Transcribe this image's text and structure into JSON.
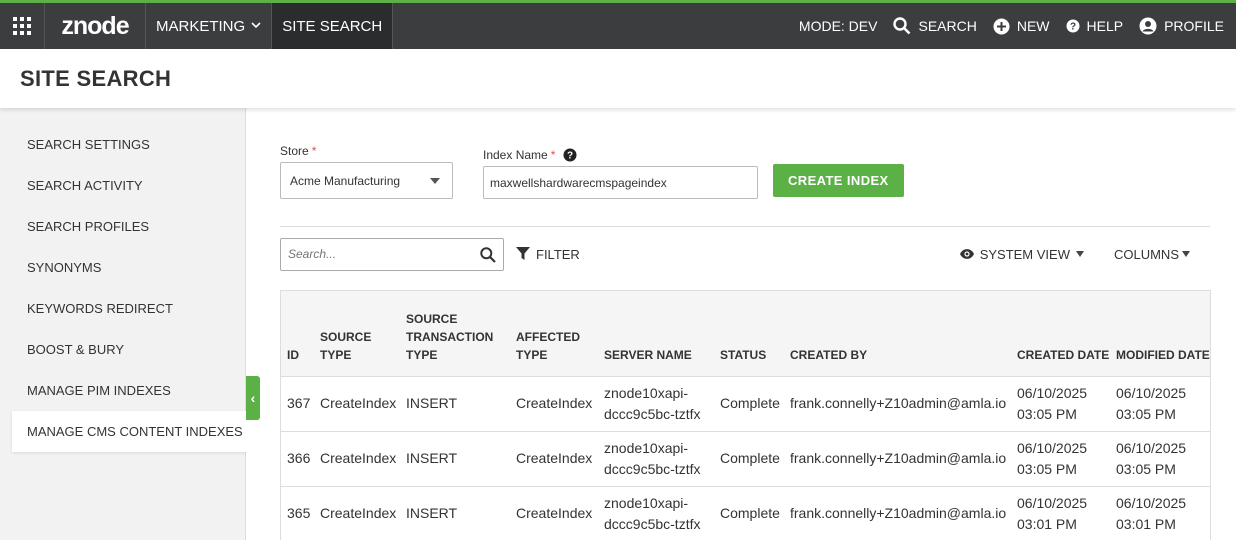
{
  "nav": {
    "logo": "znode",
    "menu": "MARKETING",
    "active": "SITE SEARCH",
    "mode": "MODE: DEV",
    "search": "SEARCH",
    "new": "NEW",
    "help": "HELP",
    "profile": "PROFILE"
  },
  "page": {
    "title": "SITE SEARCH"
  },
  "sidebar": {
    "items": [
      {
        "label": "SEARCH SETTINGS"
      },
      {
        "label": "SEARCH ACTIVITY"
      },
      {
        "label": "SEARCH PROFILES"
      },
      {
        "label": "SYNONYMS"
      },
      {
        "label": "KEYWORDS REDIRECT"
      },
      {
        "label": "BOOST & BURY"
      },
      {
        "label": "MANAGE PIM INDEXES"
      },
      {
        "label": "MANAGE CMS CONTENT INDEXES"
      }
    ],
    "collapse": "‹"
  },
  "form": {
    "store_label": "Store",
    "store_value": "Acme Manufacturing",
    "index_label": "Index Name",
    "index_value": "maxwellshardwarecmspageindex",
    "required_mark": "*",
    "create_button": "CREATE INDEX"
  },
  "toolbar": {
    "search_placeholder": "Search...",
    "filter": "FILTER",
    "system_view": "SYSTEM VIEW",
    "columns": "COLUMNS"
  },
  "table": {
    "headers": [
      "ID",
      "SOURCE TYPE",
      "SOURCE TRANSACTION TYPE",
      "AFFECTED TYPE",
      "SERVER NAME",
      "STATUS",
      "CREATED BY",
      "CREATED DATE",
      "MODIFIED DATE"
    ],
    "rows": [
      [
        "367",
        "CreateIndex",
        "INSERT",
        "CreateIndex",
        "znode10xapi-dccc9c5bc-tztfx",
        "Complete",
        "frank.connelly+Z10admin@amla.io",
        "06/10/2025 03:05 PM",
        "06/10/2025 03:05 PM"
      ],
      [
        "366",
        "CreateIndex",
        "INSERT",
        "CreateIndex",
        "znode10xapi-dccc9c5bc-tztfx",
        "Complete",
        "frank.connelly+Z10admin@amla.io",
        "06/10/2025 03:05 PM",
        "06/10/2025 03:05 PM"
      ],
      [
        "365",
        "CreateIndex",
        "INSERT",
        "CreateIndex",
        "znode10xapi-dccc9c5bc-tztfx",
        "Complete",
        "frank.connelly+Z10admin@amla.io",
        "06/10/2025 03:01 PM",
        "06/10/2025 03:01 PM"
      ]
    ]
  },
  "colors": {
    "accent": "#5cb146",
    "nav_bg": "#3c3d3f",
    "nav_active": "#2b2c2e"
  },
  "icons": [
    "apps-grid-icon",
    "search-icon",
    "plus-circle-icon",
    "help-circle-icon",
    "user-circle-icon",
    "question-icon",
    "filter-icon",
    "eye-icon",
    "chevron-down-icon",
    "chevron-left-icon"
  ]
}
